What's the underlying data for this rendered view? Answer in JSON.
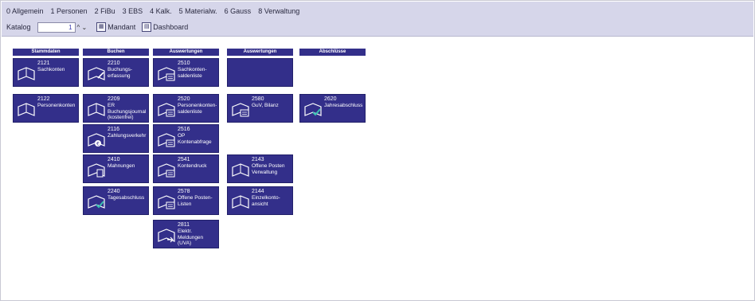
{
  "menu": [
    "0 Allgemein",
    "1 Personen",
    "2 FiBu",
    "3 EBS",
    "4 Kalk.",
    "5 Materialw.",
    "6 Gauss",
    "8 Verwaltung"
  ],
  "toolbar": {
    "katalog_label": "Katalog",
    "katalog_value": "1",
    "spin": "^ ⌄",
    "mandant": "Mandant",
    "dashboard": "Dashboard"
  },
  "columns": [
    "Stammdaten",
    "Buchen",
    "Auswertungen",
    "Auswertungen",
    "Abschlüsse"
  ],
  "tiles": [
    {
      "code": "2121",
      "label": "Sachkonten",
      "icon": "book-icon"
    },
    {
      "code": "2122",
      "label": "Personenkonten",
      "icon": "book-icon"
    },
    {
      "code": "2210",
      "label": "Buchungs-\nerfassung",
      "icon": "book-pen-icon"
    },
    {
      "code": "2209",
      "label": "ER Buchungsjournal\n(kostenfrei)",
      "icon": "book-icon"
    },
    {
      "code": "2116",
      "label": "Zahlungsverkehr",
      "icon": "book-euro-icon"
    },
    {
      "code": "2410",
      "label": "Mahnungen",
      "icon": "book-doc-icon"
    },
    {
      "code": "2240",
      "label": "Tagesabschluss",
      "icon": "book-check-icon"
    },
    {
      "code": "2510",
      "label": "Sachkonten-\nsaldenliste",
      "icon": "book-list-icon"
    },
    {
      "code": "2520",
      "label": "Personenkonten-\nsaldenliste",
      "icon": "book-list-icon"
    },
    {
      "code": "2516",
      "label": "OP\nKontenabfrage",
      "icon": "book-list-icon"
    },
    {
      "code": "2541",
      "label": "Kontendruck",
      "icon": "book-list-icon"
    },
    {
      "code": "2578",
      "label": "Offene Posten-\nListen",
      "icon": "book-list-icon"
    },
    {
      "code": "2811",
      "label": "Elektr.\nMeldungen (UVA)",
      "icon": "book-arrow-icon"
    },
    {
      "code": "2580",
      "label": "GuV, Bilanz",
      "icon": "book-list-icon"
    },
    {
      "code": "2143",
      "label": "Offene Posten\nVerwaltung",
      "icon": "book-icon"
    },
    {
      "code": "2144",
      "label": "Einzelkonto-\nansicht",
      "icon": "book-icon"
    },
    {
      "code": "2620",
      "label": "Jahresabschluss",
      "icon": "book-check-icon"
    }
  ],
  "colors": {
    "tile": "#332f8a",
    "topbar": "#d6d6ea",
    "check": "#38c0b0"
  }
}
